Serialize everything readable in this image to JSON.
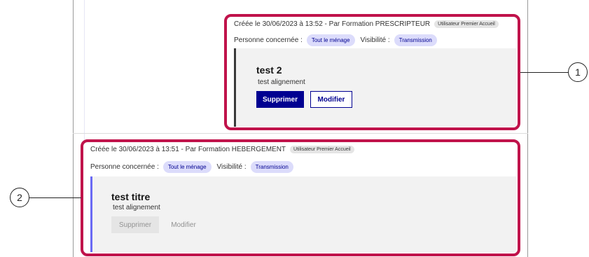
{
  "note1": {
    "meta": "Créée le 30/06/2023 à 13:52 - Par Formation PRESCRIPTEUR",
    "role": "Utilisateur Premier Accueil",
    "person_label": "Personne concernée :",
    "person_value": "Tout le ménage",
    "visibility_label": "Visibilité :",
    "visibility_value": "Transmission",
    "title": "test 2",
    "description": "test alignement",
    "delete_label": "Supprimer",
    "edit_label": "Modifier"
  },
  "note2": {
    "meta": "Créée le 30/06/2023 à 13:51 - Par Formation HEBERGEMENT",
    "role": "Utilisateur Premier Accueil",
    "person_label": "Personne concernée :",
    "person_value": "Tout le ménage",
    "visibility_label": "Visibilité :",
    "visibility_value": "Transmission",
    "title": "test titre",
    "description": "test alignement",
    "delete_label": "Supprimer",
    "edit_label": "Modifier"
  },
  "callouts": [
    "1",
    "2"
  ],
  "colors": {
    "highlight": "#c0134b",
    "primary": "#000091",
    "pill_bg": "#dcdcfb",
    "accent_bar": "#6a6af4"
  }
}
